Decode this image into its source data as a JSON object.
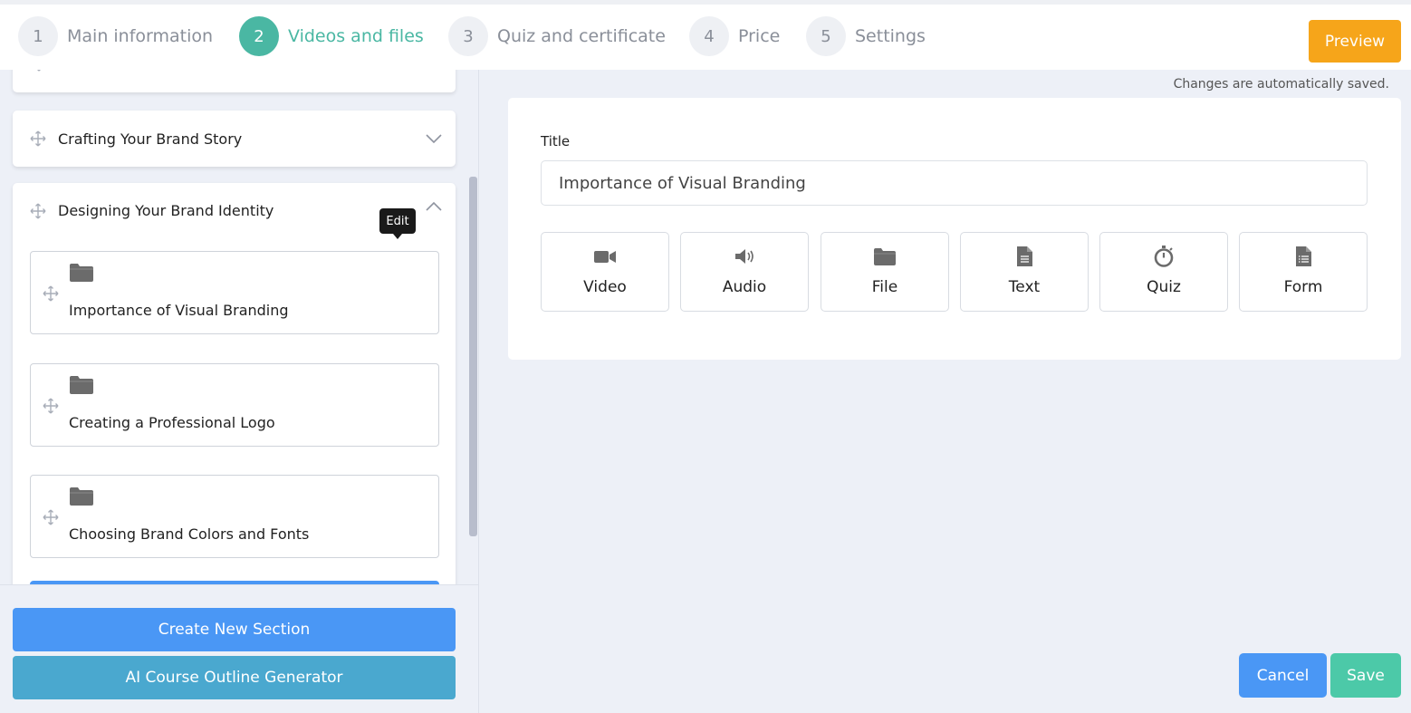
{
  "steps": [
    {
      "num": "1",
      "label": "Main information"
    },
    {
      "num": "2",
      "label": "Videos and files"
    },
    {
      "num": "3",
      "label": "Quiz and certificate"
    },
    {
      "num": "4",
      "label": "Price"
    },
    {
      "num": "5",
      "label": "Settings"
    }
  ],
  "active_step": "2",
  "preview_label": "Preview",
  "sections": [
    {
      "title": "Crafting Your Brand Story",
      "state": "collapsed"
    },
    {
      "title": "Designing Your Brand Identity",
      "state": "expanded"
    }
  ],
  "tooltip": "Edit",
  "lessons": [
    {
      "title": "Importance of Visual Branding",
      "icon": "folder-icon"
    },
    {
      "title": "Creating a Professional Logo",
      "icon": "folder-icon"
    },
    {
      "title": "Choosing Brand Colors and Fonts",
      "icon": "folder-icon"
    }
  ],
  "create_section_label": "Create New Section",
  "ai_generator_label": "AI Course Outline Generator",
  "autosave_note": "Changes are automatically saved.",
  "editor": {
    "title_label": "Title",
    "title_value": "Importance of Visual Branding",
    "content_types": [
      {
        "label": "Video",
        "icon": "video-camera-icon"
      },
      {
        "label": "Audio",
        "icon": "speaker-icon"
      },
      {
        "label": "File",
        "icon": "folder-icon"
      },
      {
        "label": "Text",
        "icon": "document-icon"
      },
      {
        "label": "Quiz",
        "icon": "stopwatch-icon"
      },
      {
        "label": "Form",
        "icon": "form-icon"
      }
    ]
  },
  "cancel_label": "Cancel",
  "save_label": "Save",
  "colors": {
    "active_step": "#4ab7a3",
    "preview": "#f6a51a",
    "primary_blue": "#4a97f5",
    "ai_button": "#4aa8cf",
    "save": "#4cc9a8"
  }
}
